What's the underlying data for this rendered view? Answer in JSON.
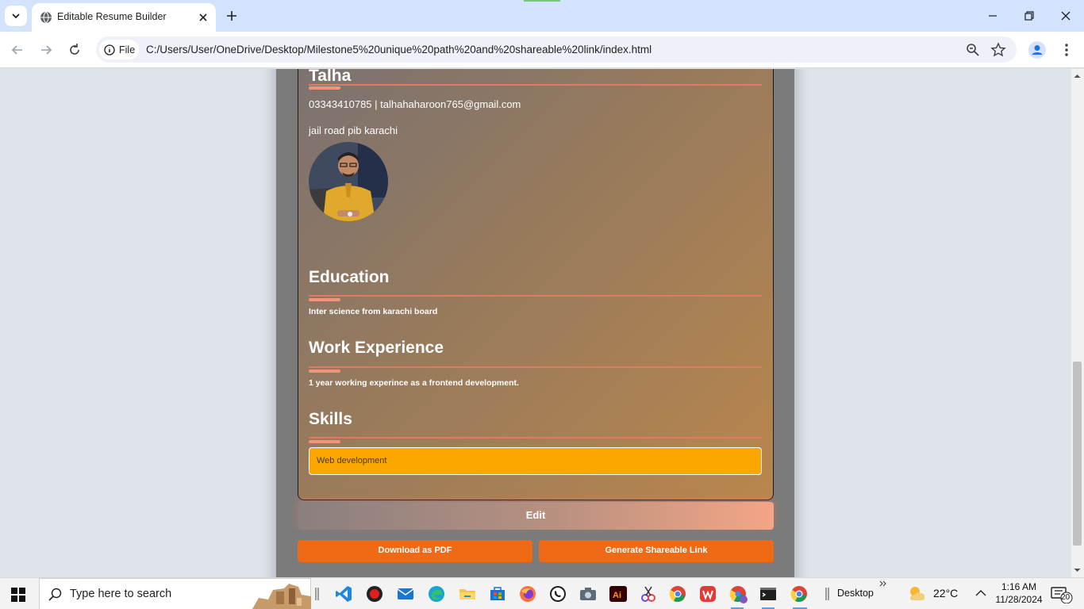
{
  "browser": {
    "tab_title": "Editable Resume Builder",
    "site_chip": "File",
    "url": "C:/Users/User/OneDrive/Desktop/Milestone5%20unique%20path%20and%20shareable%20link/index.html"
  },
  "resume": {
    "name": "Talha",
    "contact": "03343410785 | talhahaharoon765@gmail.com",
    "address": "jail road pib karachi",
    "sections": {
      "education": {
        "heading": "Education",
        "text": "Inter science from karachi board"
      },
      "work": {
        "heading": "Work Experience",
        "text": "1 year working experince as a frontend development."
      },
      "skills": {
        "heading": "Skills",
        "text": "Web development"
      }
    }
  },
  "actions": {
    "edit": "Edit",
    "download": "Download as PDF",
    "share": "Generate Shareable Link"
  },
  "taskbar": {
    "search_placeholder": "Type here to search",
    "desktop_label": "Desktop",
    "temperature": "22°C",
    "time": "1:16 AM",
    "date": "11/28/2024",
    "notification_count": "20"
  },
  "colors": {
    "accent_orange": "#ee6a16",
    "skill_yellow": "#fca600",
    "rule_color": "#e07a62"
  }
}
